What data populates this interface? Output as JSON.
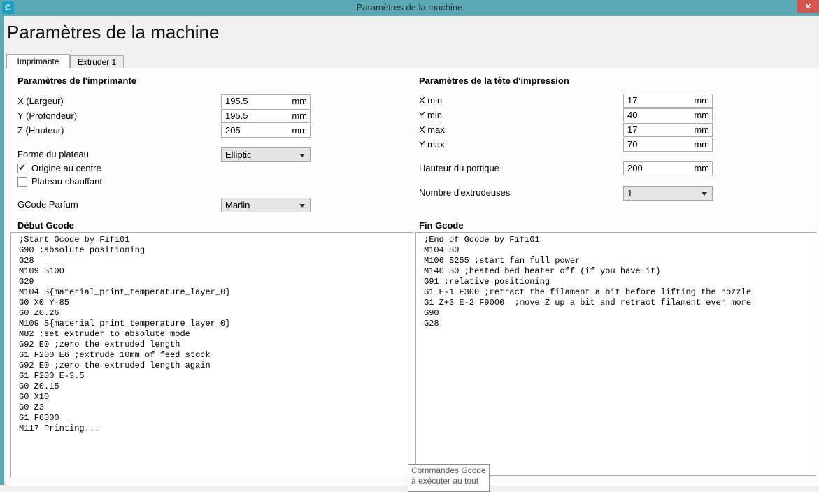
{
  "window": {
    "title": "Paramètres de la machine",
    "icon_letter": "C",
    "close_glyph": "✕"
  },
  "header": {
    "title": "Paramètres de la machine"
  },
  "tabs": [
    {
      "label": "Imprimante",
      "active": true
    },
    {
      "label": "Extruder 1",
      "active": false
    }
  ],
  "printer_settings": {
    "section_title": "Paramètres de l'imprimante",
    "fields": [
      {
        "label": "X (Largeur)",
        "value": "195.5",
        "unit": "mm"
      },
      {
        "label": "Y (Profondeur)",
        "value": "195.5",
        "unit": "mm"
      },
      {
        "label": "Z (Hauteur)",
        "value": "205",
        "unit": "mm"
      }
    ],
    "bed_shape": {
      "label": "Forme du plateau",
      "value": "Elliptic"
    },
    "checkboxes": [
      {
        "label": "Origine au centre",
        "checked": true
      },
      {
        "label": "Plateau chauffant",
        "checked": false
      }
    ],
    "gcode_flavor": {
      "label": "GCode Parfum",
      "value": "Marlin"
    }
  },
  "printhead_settings": {
    "section_title": "Paramètres de la tête d'impression",
    "fields": [
      {
        "label": "X min",
        "value": "17",
        "unit": "mm"
      },
      {
        "label": "Y min",
        "value": "40",
        "unit": "mm"
      },
      {
        "label": "X max",
        "value": "17",
        "unit": "mm"
      },
      {
        "label": "Y max",
        "value": "70",
        "unit": "mm"
      }
    ],
    "gantry_height": {
      "label": "Hauteur du portique",
      "value": "200",
      "unit": "mm"
    },
    "extruder_count": {
      "label": "Nombre d'extrudeuses",
      "value": "1"
    }
  },
  "start_gcode": {
    "label": "Début Gcode",
    "content": ";Start Gcode by Fifi01\nG90 ;absolute positioning\nG28\nM109 S100\nG29\nM104 S{material_print_temperature_layer_0}\nG0 X0 Y-85\nG0 Z0.26\nM109 S{material_print_temperature_layer_0}\nM82 ;set extruder to absolute mode\nG92 E0 ;zero the extruded length\nG1 F200 E6 ;extrude 10mm of feed stock\nG92 E0 ;zero the extruded length again\nG1 F200 E-3.5\nG0 Z0.15\nG0 X10\nG0 Z3\nG1 F6000\nM117 Printing..."
  },
  "end_gcode": {
    "label": "Fin Gcode",
    "content": ";End of Gcode by Fifi01\nM104 S0\nM106 S255 ;start fan full power\nM140 S0 ;heated bed heater off (if you have it)\nG91 ;relative positioning\nG1 E-1 F300 ;retract the filament a bit before lifting the nozzle\nG1 Z+3 E-2 F9000  ;move Z up a bit and retract filament even more\nG90\nG28"
  },
  "tooltip": {
    "lines": [
      "Commandes Gcode",
      "à exécuter au tout"
    ]
  },
  "colors": {
    "titlebar_teal": "#5ca9b6",
    "icon_blue": "#16a1c9",
    "close_red": "#d65550",
    "dialog_bg": "#f0f0f0",
    "panel_bg": "#fcfcfc"
  }
}
